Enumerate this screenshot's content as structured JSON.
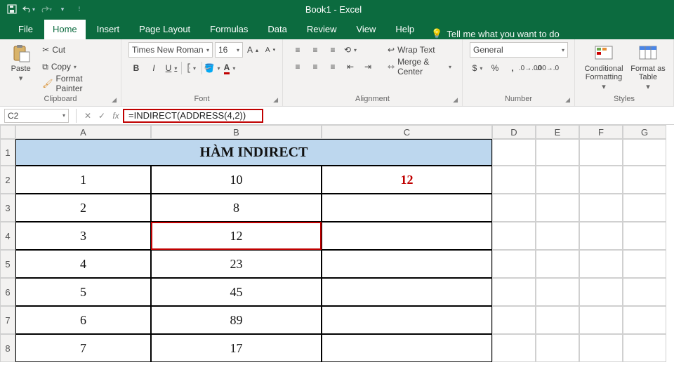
{
  "app": {
    "title": "Book1 - Excel"
  },
  "tabs": {
    "file": "File",
    "home": "Home",
    "insert": "Insert",
    "page_layout": "Page Layout",
    "formulas": "Formulas",
    "data": "Data",
    "review": "Review",
    "view": "View",
    "help": "Help",
    "tell_me": "Tell me what you want to do"
  },
  "ribbon": {
    "clipboard": {
      "paste": "Paste",
      "cut": "Cut",
      "copy": "Copy",
      "format_painter": "Format Painter",
      "label": "Clipboard"
    },
    "font": {
      "name": "Times New Roman",
      "size": "16",
      "label": "Font"
    },
    "alignment": {
      "wrap": "Wrap Text",
      "merge": "Merge & Center",
      "label": "Alignment"
    },
    "number": {
      "format": "General",
      "label": "Number"
    },
    "styles": {
      "cond": "Conditional Formatting",
      "table": "Format as Table",
      "label": "Styles"
    }
  },
  "formula_bar": {
    "name_box": "C2",
    "formula": "=INDIRECT(ADDRESS(4,2))",
    "fx": "fx"
  },
  "columns": [
    "A",
    "B",
    "C",
    "D",
    "E",
    "F",
    "G"
  ],
  "rows": [
    "1",
    "2",
    "3",
    "4",
    "5",
    "6",
    "7",
    "8"
  ],
  "sheet": {
    "title": "HÀM INDIRECT",
    "c2": "12",
    "a": [
      "1",
      "2",
      "3",
      "4",
      "5",
      "6",
      "7"
    ],
    "b": [
      "10",
      "8",
      "12",
      "23",
      "45",
      "89",
      "17"
    ]
  },
  "chart_data": {
    "type": "table",
    "title": "HÀM INDIRECT",
    "columns": [
      "A",
      "B"
    ],
    "rows": [
      {
        "A": 1,
        "B": 10
      },
      {
        "A": 2,
        "B": 8
      },
      {
        "A": 3,
        "B": 12
      },
      {
        "A": 4,
        "B": 23
      },
      {
        "A": 5,
        "B": 45
      },
      {
        "A": 6,
        "B": 89
      },
      {
        "A": 7,
        "B": 17
      }
    ],
    "formula_cell": {
      "ref": "C2",
      "formula": "=INDIRECT(ADDRESS(4,2))",
      "value": 12
    }
  }
}
